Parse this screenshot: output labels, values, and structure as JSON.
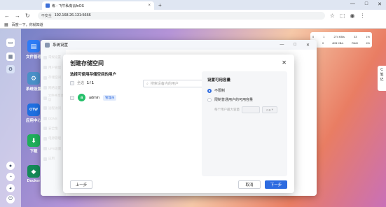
{
  "browser": {
    "tab_title": "练 - 飞牛私有云fnOS",
    "new_tab": "+",
    "security_label": "不安全",
    "url": "192.168.26.131:5666",
    "bookmark": "百度一下，你就知道"
  },
  "desktop": {
    "apps": [
      {
        "label": "文件管理",
        "icon": "folder-icon",
        "color": "#2e7cf6"
      },
      {
        "label": "系统设置",
        "icon": "gear-icon",
        "color": "#4a90c8"
      },
      {
        "label": "应用中心",
        "icon": "store-icon",
        "color": "#1f6fe0"
      },
      {
        "label": "下载",
        "icon": "download-icon",
        "color": "#1fae5a"
      },
      {
        "label": "Docker",
        "icon": "docker-icon",
        "color": "#148a58"
      }
    ],
    "sysstats": {
      "row1": [
        "0",
        "1",
        "274 KB/s",
        "33",
        "1%"
      ],
      "row2": [
        "0",
        "0",
        "4KB KB/s",
        "RAM",
        "4%"
      ]
    },
    "side_note": "C\n笔\n记"
  },
  "window": {
    "title": "系统设置",
    "sidebar": [
      "常规设置",
      "用户管理",
      "存储空间",
      "网络设置",
      "文件共享协议",
      "远程访问",
      "DDNS",
      "安全性",
      "电源管理",
      "UPS设置",
      "应用"
    ]
  },
  "dialog": {
    "title": "创建存储空间",
    "users_label": "选择可使用存储空间的用户",
    "select_all": "全选",
    "selected_count": "1 / 1",
    "search_placeholder": "搜索设备内的用户",
    "user": {
      "avatar": "a",
      "name": "admin",
      "badge": "管理员"
    },
    "quota_label": "设置可用容量",
    "opt_unlimited": "不限制",
    "opt_limit": "限制普通用户的可用容量",
    "per_user_label": "每个用户最大容量",
    "unit": "GB",
    "btn_prev": "上一步",
    "btn_cancel": "取消",
    "btn_next": "下一步"
  }
}
